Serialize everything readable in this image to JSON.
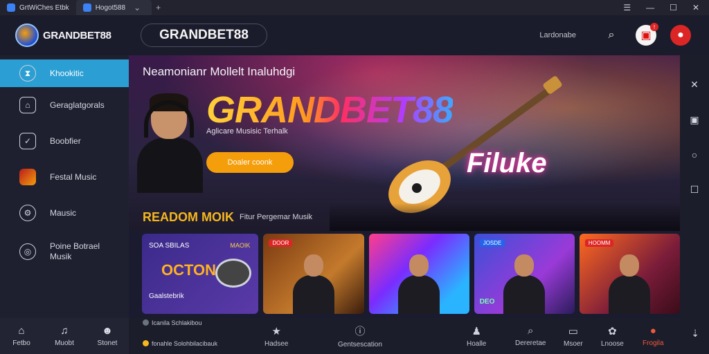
{
  "browser": {
    "tabs": [
      {
        "label": "GrtWiChes Etbk"
      },
      {
        "label": "Hogot588"
      }
    ],
    "chevron": "⌄",
    "new_tab": "+"
  },
  "header": {
    "brand_name": "GRANDBET88",
    "brand_pill": "GRANDBET88",
    "link_label": "Lardonabe",
    "bell_badge": "!"
  },
  "sidebar": {
    "items": [
      {
        "label": "Khookitic",
        "icon": "hourglass-icon"
      },
      {
        "label": "Geraglatgorals",
        "icon": "home-icon"
      },
      {
        "label": "Boobfier",
        "icon": "check-box-icon"
      },
      {
        "label": "Festal Music",
        "icon": "album-icon"
      },
      {
        "label": "Mausic",
        "icon": "gear-icon"
      },
      {
        "label": "Poine Botrael Musik",
        "icon": "target-icon"
      }
    ]
  },
  "hero": {
    "top_text": "Neamonianr Mollelt Inaluhdgi",
    "title": "GRANDBET88",
    "subtitle": "Aglicare Musisic Terhalk",
    "cta": "Doaler coonk",
    "tagline": "Filuke"
  },
  "section": {
    "title": "READOM MOIK",
    "subtitle": "Fitur Pergemar Musik"
  },
  "cards": [
    {
      "top_left": "SOA SBILAS",
      "top_right": "MAOIK",
      "logo": "OCTON",
      "bottom": "Gaalstebrik"
    },
    {
      "badge": "DOOR"
    },
    {
      "badge": ""
    },
    {
      "badge": "JOSDE",
      "code": "DEO"
    },
    {
      "badge": "HOOMM"
    }
  ],
  "bottom_nav": {
    "left": [
      {
        "label": "Fetbo",
        "icon": "home-icon"
      },
      {
        "label": "Muobt",
        "icon": "music-icon"
      },
      {
        "label": "Stonet",
        "icon": "user-icon"
      }
    ],
    "items": [
      {
        "label": "Hadsee",
        "icon": "star-icon"
      },
      {
        "label": "Gentsescation",
        "icon": "info-icon"
      },
      {
        "label": "Hoalle",
        "icon": "person-icon"
      },
      {
        "label": "Dereretae",
        "icon": "search-icon"
      },
      {
        "label": "Msoer",
        "icon": "chat-icon"
      },
      {
        "label": "Lnoose",
        "icon": "gear-icon"
      },
      {
        "label": "Frogila",
        "icon": "profile-icon"
      }
    ],
    "footnote_top": "Icanila Schlakibou",
    "footnote_bottom": "fonahle Solohbilacibauk"
  },
  "colors": {
    "accent": "#2b9fd4",
    "brand_orange": "#f59e0b",
    "active_nav": "#f05a3a"
  }
}
